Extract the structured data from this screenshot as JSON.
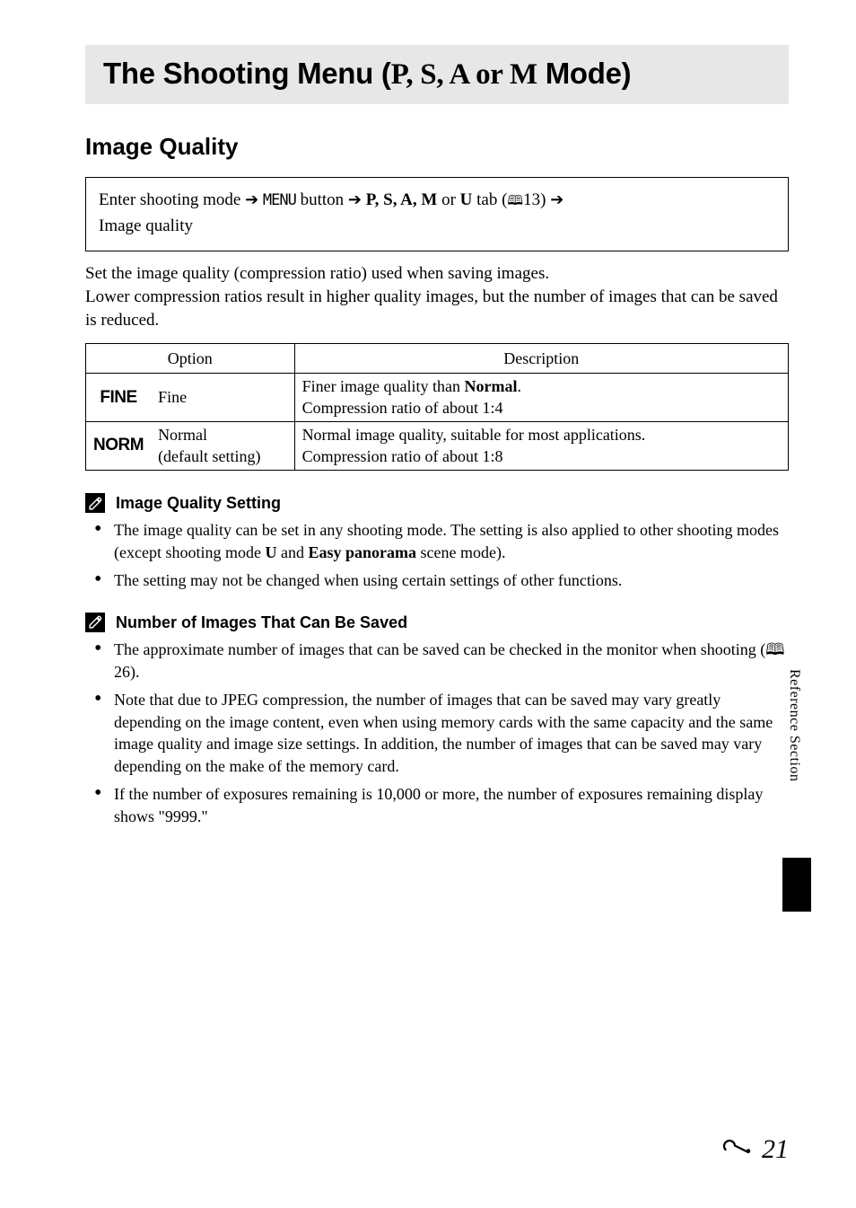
{
  "title": {
    "prefix": "The Shooting Menu (",
    "modes": "P, S, A or M",
    "suffix": " Mode)"
  },
  "section_heading": "Image Quality",
  "nav": {
    "part1": "Enter shooting mode ",
    "menu_word": "MENU",
    "button_word": " button ",
    "modes_prefix": " ",
    "modes": "P, S, A, M",
    "or": " or ",
    "last_mode": "U",
    "tab_word": " tab (",
    "pageref": "13",
    "closeparen": ") ",
    "lastline": "Image quality"
  },
  "intro": "Set the image quality (compression ratio) used when saving images.\nLower compression ratios result in higher quality images, but the number of images that can be saved is reduced.",
  "table": {
    "h1": "Option",
    "h2": "Description",
    "rows": [
      {
        "icon": "FINE",
        "name": "Fine",
        "desc_pre": "Finer image quality than ",
        "desc_bold": "Normal",
        "desc_post": ".\nCompression ratio of about 1:4"
      },
      {
        "icon": "NORM",
        "name": "Normal\n(default setting)",
        "desc_pre": "Normal image quality, suitable for most applications.\nCompression ratio of about 1:8",
        "desc_bold": "",
        "desc_post": ""
      }
    ]
  },
  "note1": {
    "title": "Image Quality Setting",
    "b1_pre": "The image quality can be set in any shooting mode. The setting is also applied to other shooting modes (except shooting mode ",
    "b1_mode": "U",
    "b1_and": " and ",
    "b1_bold": "Easy panorama",
    "b1_post": " scene mode).",
    "b2": "The setting may not be changed when using certain settings of other functions."
  },
  "note2": {
    "title": "Number of Images That Can Be Saved",
    "b1_pre": "The approximate number of images that can be saved can be checked in the monitor when shooting (",
    "b1_ref": "26",
    "b1_post": ").",
    "b2": "Note that due to JPEG compression, the number of images that can be saved may vary greatly depending on the image content, even when using memory cards with the same capacity and the same image quality and image size settings. In addition, the number of images that can be saved may vary depending on the make of the memory card.",
    "b3": "If the number of exposures remaining is 10,000 or more, the number of exposures remaining display shows \"9999.\""
  },
  "side_label": "Reference Section",
  "page_number": "21"
}
